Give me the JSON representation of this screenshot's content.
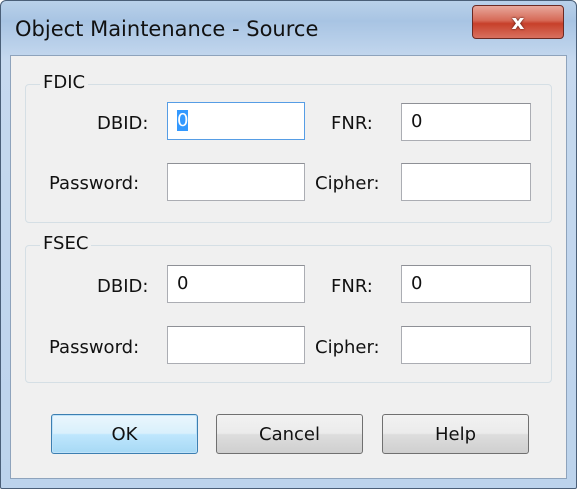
{
  "window": {
    "title": "Object Maintenance - Source",
    "close_glyph": "x"
  },
  "fdic": {
    "legend": "FDIC",
    "dbid_label": "DBID:",
    "dbid_value": "0",
    "fnr_label": "FNR:",
    "fnr_value": "0",
    "password_label": "Password:",
    "password_value": "",
    "cipher_label": "Cipher:",
    "cipher_value": ""
  },
  "fsec": {
    "legend": "FSEC",
    "dbid_label": "DBID:",
    "dbid_value": "0",
    "fnr_label": "FNR:",
    "fnr_value": "0",
    "password_label": "Password:",
    "password_value": "",
    "cipher_label": "Cipher:",
    "cipher_value": ""
  },
  "buttons": {
    "ok": "OK",
    "cancel": "Cancel",
    "help": "Help"
  },
  "colors": {
    "titlebar": "#b9d1ea",
    "close_button": "#c7402a",
    "selection": "#3399ff",
    "focus_border": "#569de5"
  },
  "icons": {
    "close": "close-icon"
  }
}
